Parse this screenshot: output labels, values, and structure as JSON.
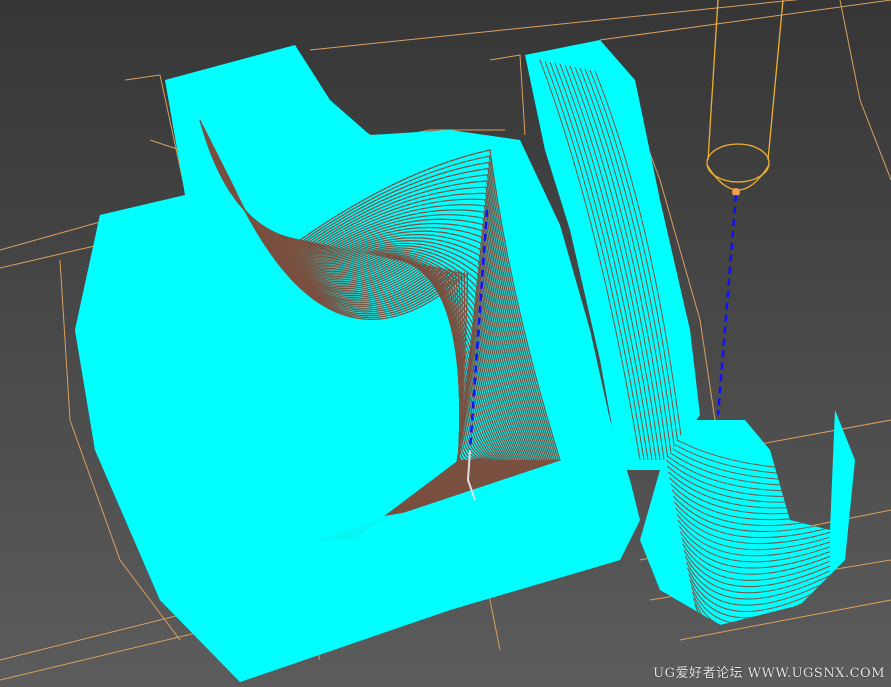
{
  "viewport": {
    "description_label": "3D toolpath graphics view",
    "colors": {
      "background_top": "#363636",
      "background_bottom": "#5c5c5c",
      "toolpath": "#00ffff",
      "toolpath_gap": "#7a5040",
      "wireframe": "#d9a060",
      "tool": "#f0b030",
      "engage_path": "#1010ff"
    }
  },
  "watermark": "UG爱好者论坛 WWW.UGSNX.COM"
}
